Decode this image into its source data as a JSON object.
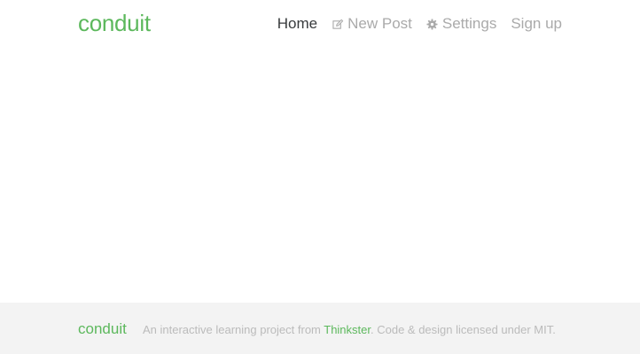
{
  "header": {
    "brand": "conduit",
    "nav": [
      {
        "label": "Home",
        "icon": null,
        "active": true
      },
      {
        "label": "New Post",
        "icon": "edit-icon",
        "active": false
      },
      {
        "label": "Settings",
        "icon": "gear-icon",
        "active": false
      },
      {
        "label": "Sign up",
        "icon": null,
        "active": false
      }
    ]
  },
  "footer": {
    "logo": "conduit",
    "attribution_prefix": "An interactive learning project from ",
    "attribution_link": "Thinkster",
    "attribution_suffix": ". Code & design licensed under MIT."
  },
  "colors": {
    "brand": "#5cb85c",
    "nav_inactive": "#aaaaaa",
    "nav_active": "#373a3c",
    "footer_bg": "#f3f3f3",
    "footer_text": "#bbbbbb"
  }
}
